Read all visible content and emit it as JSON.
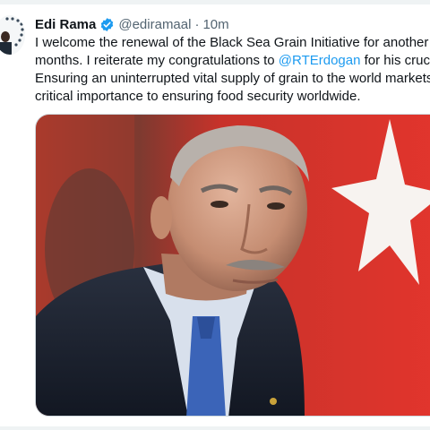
{
  "tweet": {
    "author_name": "Edi Rama",
    "handle": "@ediramaal",
    "separator": "·",
    "time": "10m",
    "text_lines": [
      [
        "I welcome the renewal of the Black Sea Grain Initiative for another tw"
      ],
      [
        "months. I reiterate my congratulations to ",
        "@RTErdogan",
        " for his crucial"
      ],
      [
        "Ensuring an uninterrupted vital supply of grain to the world markets i"
      ],
      [
        "critical importance to ensuring food security worldwide."
      ]
    ],
    "mention": "@RTErdogan",
    "avatar_icon": "profile-avatar-icon",
    "verified_icon": "verified-badge-icon",
    "verified_color": "#1d9bf0",
    "media_description": "photo"
  },
  "colors": {
    "accent": "#1d9bf0",
    "text": "#0f1419",
    "secondary": "#536471"
  }
}
